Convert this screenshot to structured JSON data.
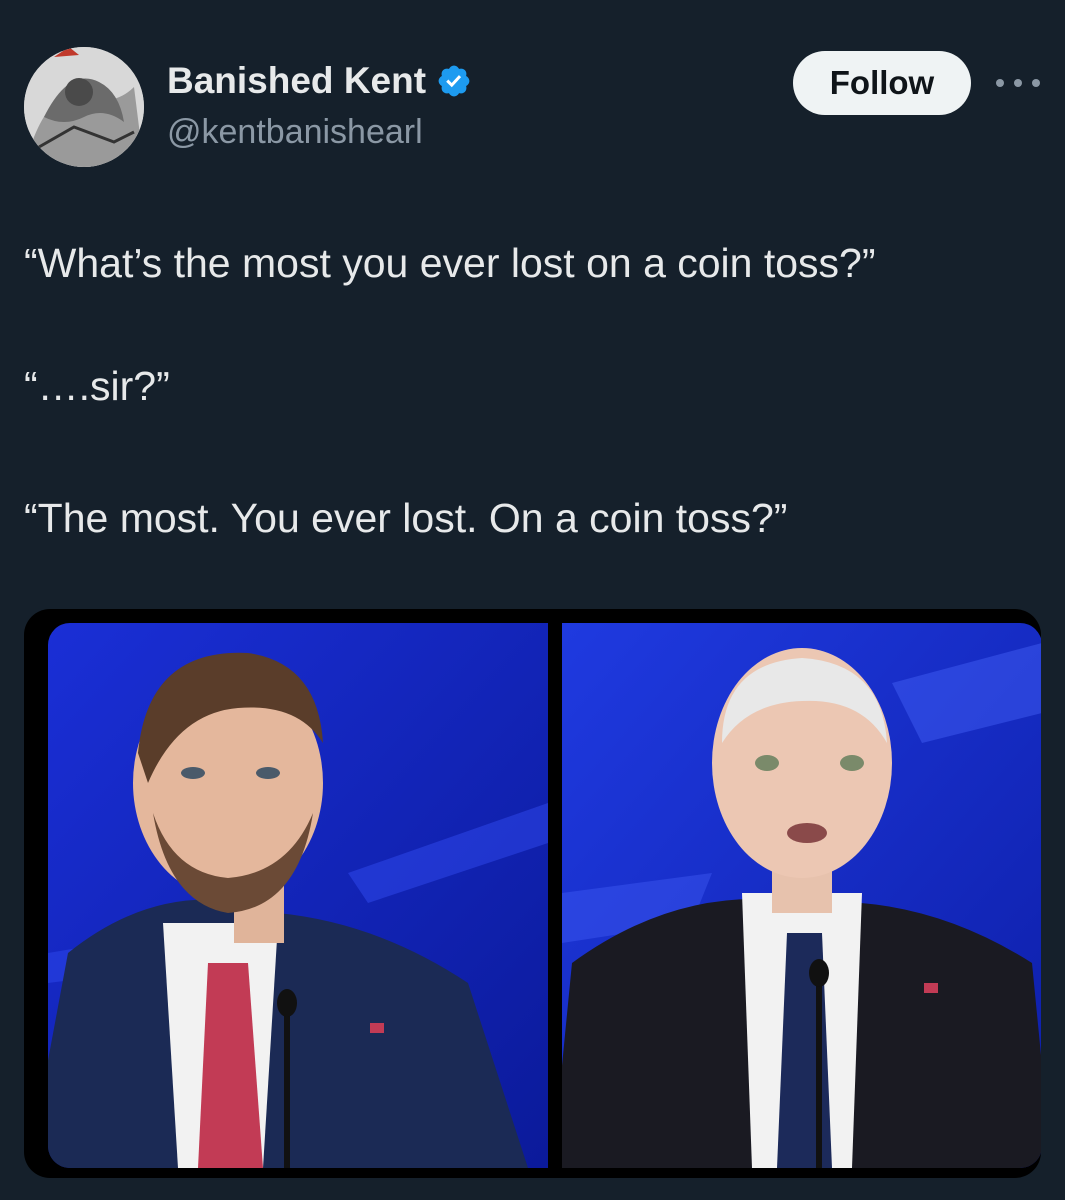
{
  "tweet": {
    "author": {
      "display_name": "Banished Kent",
      "handle": "@kentbanishearl",
      "verified_icon": "verified-badge-icon",
      "verified_color": "#1d9bf0"
    },
    "follow_label": "Follow",
    "more_icon": "more-options-icon",
    "text_lines": [
      "“What’s the most you ever lost on a coin toss?”",
      "“….sir?”",
      "“The most. You ever lost. On a coin toss?”"
    ]
  },
  "colors": {
    "background": "#15202b",
    "primary_text": "#e7e9ea",
    "secondary_text": "#8b98a5",
    "follow_button_bg": "#eff3f4",
    "follow_button_text": "#0f1419"
  }
}
